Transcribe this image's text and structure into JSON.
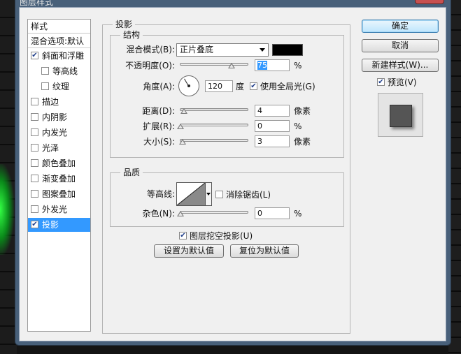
{
  "window": {
    "title": "图层样式"
  },
  "styles_list": {
    "header": "样式",
    "blend_options": "混合选项:默认",
    "items": [
      {
        "label": "斜面和浮雕",
        "checked": true,
        "sub": false,
        "active": false
      },
      {
        "label": "等高线",
        "checked": false,
        "sub": true,
        "active": false
      },
      {
        "label": "纹理",
        "checked": false,
        "sub": true,
        "active": false
      },
      {
        "label": "描边",
        "checked": false,
        "sub": false,
        "active": false
      },
      {
        "label": "内阴影",
        "checked": false,
        "sub": false,
        "active": false
      },
      {
        "label": "内发光",
        "checked": false,
        "sub": false,
        "active": false
      },
      {
        "label": "光泽",
        "checked": false,
        "sub": false,
        "active": false
      },
      {
        "label": "颜色叠加",
        "checked": false,
        "sub": false,
        "active": false
      },
      {
        "label": "渐变叠加",
        "checked": false,
        "sub": false,
        "active": false
      },
      {
        "label": "图案叠加",
        "checked": false,
        "sub": false,
        "active": false
      },
      {
        "label": "外发光",
        "checked": false,
        "sub": false,
        "active": false
      },
      {
        "label": "投影",
        "checked": true,
        "sub": false,
        "active": true
      }
    ]
  },
  "drop_shadow": {
    "section_title": "投影",
    "structure": {
      "title": "结构",
      "blend_mode_label": "混合模式(B):",
      "blend_mode_value": "正片叠底",
      "shadow_color": "#000000",
      "opacity_label": "不透明度(O):",
      "opacity_value": "75",
      "opacity_unit": "%",
      "opacity_level": 0.75,
      "angle_label": "角度(A):",
      "angle_value": "120",
      "angle_unit": "度",
      "global_light_label": "使用全局光(G)",
      "global_light_checked": true,
      "distance_label": "距离(D):",
      "distance_value": "4",
      "distance_unit": "像素",
      "spread_label": "扩展(R):",
      "spread_value": "0",
      "spread_unit": "%",
      "size_label": "大小(S):",
      "size_value": "3",
      "size_unit": "像素"
    },
    "quality": {
      "title": "品质",
      "contour_label": "等高线:",
      "anti_alias_label": "消除锯齿(L)",
      "anti_alias_checked": false,
      "noise_label": "杂色(N):",
      "noise_value": "0",
      "noise_unit": "%"
    },
    "knockout_label": "图层挖空投影(U)",
    "knockout_checked": true,
    "make_default": "设置为默认值",
    "reset_default": "复位为默认值"
  },
  "buttons": {
    "ok": "确定",
    "cancel": "取消",
    "new_style": "新建样式(W)...",
    "preview_label": "预览(V)",
    "preview_checked": true
  }
}
